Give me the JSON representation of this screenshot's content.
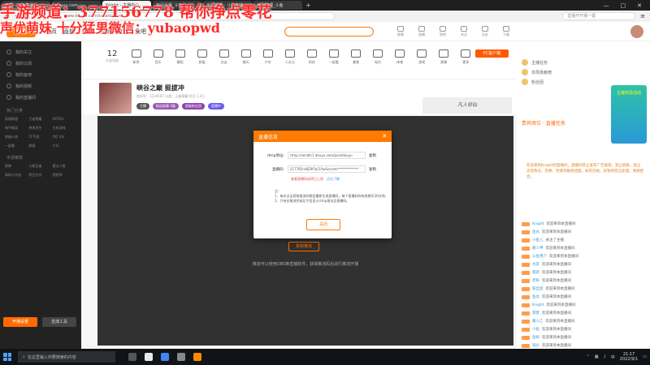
{
  "watermark": {
    "line1": "手游频道：377156778  帮你挣点零花",
    "line2": "声优萌妹 十分猛男微信：yubaopwd"
  },
  "tabs": [
    {
      "label": "开播 - 斗鱼直播",
      "active": false
    },
    {
      "label": "douyu.com",
      "active": false
    },
    {
      "label": "Knight - 主播中心",
      "active": true
    },
    {
      "label": "房间设置_斗鱼",
      "active": false
    },
    {
      "label": "房间管理 - 斗鱼直播",
      "active": false
    },
    {
      "label": "房间管理_斗鱼",
      "active": false
    }
  ],
  "address": {
    "url": "www.douyu.com/creator/live",
    "search_placeholder": "直播开开播一键"
  },
  "site": {
    "logo": "斗鱼",
    "nav": [
      "首页",
      "直播",
      "分类",
      "视频",
      "游戏",
      "鱼吧"
    ],
    "header_icons": [
      "赛事",
      "直播",
      "鱼吧",
      "关注",
      "历史",
      "下载"
    ]
  },
  "sidebar": {
    "items": [
      "我的关注",
      "我的订阅",
      "我的鱼吧",
      "我的视频",
      "我的直播间"
    ],
    "section1": "热门分类",
    "grid1": [
      "英雄联盟",
      "王者荣耀",
      "DOTA2",
      "和平精英",
      "绝地求生",
      "主机游戏",
      "穿越火线",
      "CF手游",
      "QQ飞车",
      "一起看",
      "颜值",
      "户外"
    ],
    "section2": "手游推荐",
    "grid2": [
      "原神",
      "火影忍者",
      "第五人格",
      "球球大作战",
      "明日方舟",
      "阴阳师"
    ],
    "btn1": "开播设置",
    "btn2": "直播工具"
  },
  "categories": {
    "count": "12",
    "count_label": "分类导航",
    "items": [
      "新秀",
      "音乐",
      "舞蹈",
      "颜值",
      "交友",
      "聊天",
      "户外",
      "二次元",
      "科技",
      "一起看",
      "美食",
      "电台",
      "体育",
      "游戏",
      "赛事",
      "更多"
    ],
    "right_btn": "PC客户端"
  },
  "room": {
    "title": "峡谷之巅 挺拔冲",
    "sub": "房间号：1234567  分类：王者荣耀  关注 1.2万",
    "badges": [
      "主播",
      "粉丝勋章 2级",
      "超级粉丝团",
      "直播中"
    ],
    "banner": "凡人修仙"
  },
  "dialog": {
    "title": "直播信息",
    "rtmp_label": "rtmp地址:",
    "rtmp_value": "rtmp://sendtc1.douyu.com/pushdouyu",
    "code_label": "直播码:",
    "code_value": "217785rsNZ0f?pCLYwSecrets*************",
    "copy": "复制",
    "warn": "查看直播码说明已上线",
    "warn_link": "点击了解",
    "notes_title": "注：",
    "note1": "1、每次点击获取推流码都会重新生成直播码，每个直播码的有效期为30分钟。",
    "note2": "2、只有在推流完成后才会显示rtmp地址及直播码。",
    "ok": "关闭"
  },
  "player": {
    "btn": "复制推流",
    "note": "推流可以使用OBS等直播软件，获得推流码后进行推流开播"
  },
  "right": {
    "rows": [
      "主播任务",
      "本周贡献榜",
      "粉丝团"
    ],
    "tab": "贵宾席位 · 直播任务",
    "ad": "主播奖励活动",
    "desc": "欢迎来到Knight的直播间，直播间禁止发布广告链接，禁止刷屏，禁止涉及政治、宗教、色情等敏感话题。如有违规，房管将禁言处理，谢谢配合。",
    "chat": [
      {
        "name": "Knight",
        "msg": "欢迎来到本直播间"
      },
      {
        "name": "鱼丸",
        "msg": "欢迎来到本直播间"
      },
      {
        "name": "小鱼儿",
        "msg": "关注了主播"
      },
      {
        "name": "路人甲",
        "msg": "欢迎来到本直播间"
      },
      {
        "name": "斗鱼用户",
        "msg": "欢迎来到本直播间"
      },
      {
        "name": "水友",
        "msg": "欢迎来到本直播间"
      },
      {
        "name": "萌新",
        "msg": "欢迎来到本直播间"
      },
      {
        "name": "老粉",
        "msg": "欢迎来到本直播间"
      },
      {
        "name": "粉丝团",
        "msg": "欢迎来到本直播间"
      },
      {
        "name": "鱼丸",
        "msg": "欢迎来到本直播间"
      },
      {
        "name": "Knight",
        "msg": "欢迎来到本直播间"
      },
      {
        "name": "游客",
        "msg": "欢迎来到本直播间"
      },
      {
        "name": "路人乙",
        "msg": "欢迎来到本直播间"
      },
      {
        "name": "小鱼",
        "msg": "欢迎来到本直播间"
      },
      {
        "name": "鱼粉",
        "msg": "欢迎来到本直播间"
      },
      {
        "name": "观众",
        "msg": "欢迎来到本直播间"
      }
    ]
  },
  "taskbar": {
    "search": "在这里输入你要搜索的内容",
    "time": "21:17",
    "date": "2022/9/1",
    "lang": "中"
  }
}
